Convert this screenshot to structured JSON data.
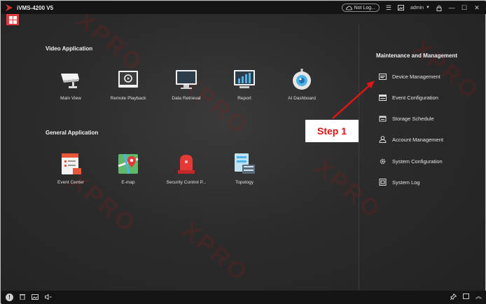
{
  "titlebar": {
    "app_title": "iVMS-4200 V5",
    "network_status": "Not Log...",
    "user": "admin",
    "icons": [
      "cloud-icon",
      "menu-icon",
      "image-icon",
      "user-icon",
      "lock-icon",
      "minimize-icon",
      "maximize-icon",
      "close-icon"
    ]
  },
  "video_application": {
    "title": "Video Application",
    "tiles": [
      {
        "label": "Main View",
        "icon": "camera-icon"
      },
      {
        "label": "Remote Playback",
        "icon": "playback-icon"
      },
      {
        "label": "Data Retrieval",
        "icon": "monitor-icon"
      },
      {
        "label": "Report",
        "icon": "chart-icon"
      },
      {
        "label": "AI Dashboard",
        "icon": "robot-icon"
      }
    ]
  },
  "general_application": {
    "title": "General Application",
    "tiles": [
      {
        "label": "Event Center",
        "icon": "event-icon"
      },
      {
        "label": "E-map",
        "icon": "map-icon"
      },
      {
        "label": "Security Control P...",
        "icon": "alarm-icon"
      },
      {
        "label": "Topology",
        "icon": "topology-icon"
      }
    ]
  },
  "maintenance": {
    "title": "Maintenance and Management",
    "items": [
      {
        "label": "Device Management",
        "icon": "device-icon"
      },
      {
        "label": "Event Configuration",
        "icon": "event-config-icon"
      },
      {
        "label": "Storage Schedule",
        "icon": "storage-icon"
      },
      {
        "label": "Account Management",
        "icon": "account-icon"
      },
      {
        "label": "System Configuration",
        "icon": "settings-icon"
      },
      {
        "label": "System Log",
        "icon": "log-icon"
      }
    ]
  },
  "annotation": {
    "step_label": "Step 1",
    "color": "#dd1111"
  },
  "watermark": "XPRO",
  "bottombar": {
    "left_icons": [
      "alert-icon",
      "trash-icon",
      "image-icon",
      "speaker-icon"
    ],
    "right_icons": [
      "pin-icon",
      "window-icon",
      "collapse-icon"
    ]
  },
  "colors": {
    "accent": "#e03a3a",
    "background": "#2b2b2b",
    "titlebar": "#141414"
  }
}
